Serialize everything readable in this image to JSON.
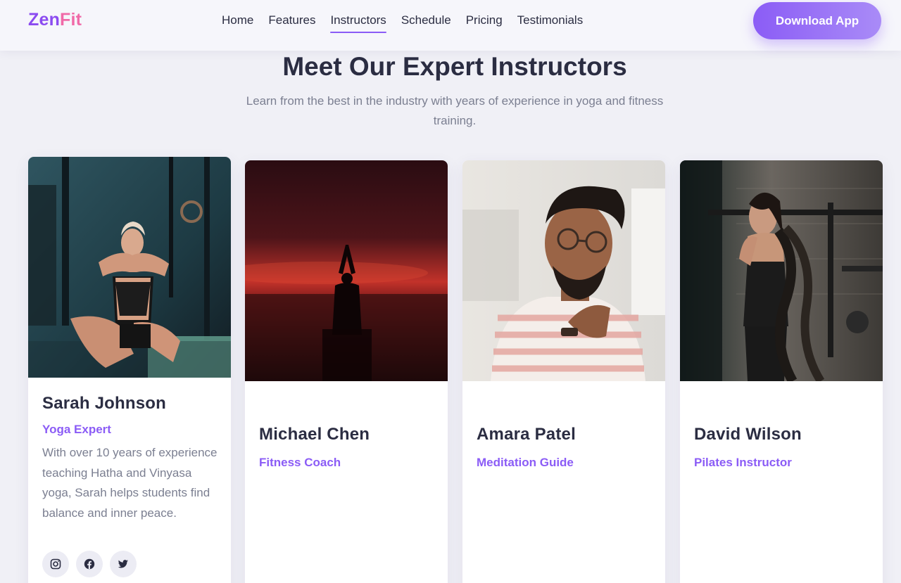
{
  "brand": {
    "part1": "Zen",
    "part2": "Fit"
  },
  "nav": {
    "links": [
      {
        "label": "Home"
      },
      {
        "label": "Features"
      },
      {
        "label": "Instructors",
        "active": true
      },
      {
        "label": "Schedule"
      },
      {
        "label": "Pricing"
      },
      {
        "label": "Testimonials"
      }
    ],
    "cta_label": "Download App"
  },
  "section": {
    "title": "Meet Our Expert Instructors",
    "subtitle": "Learn from the best in the industry with years of experience in yoga and fitness training."
  },
  "instructors": [
    {
      "name": "Sarah Johnson",
      "role": "Yoga Expert",
      "bio": "With over 10 years of experience teaching Hatha and Vinyasa yoga, Sarah helps students find balance and inner peace.",
      "socials": [
        "instagram-icon",
        "facebook-icon",
        "twitter-icon"
      ]
    },
    {
      "name": "Michael Chen",
      "role": "Fitness Coach"
    },
    {
      "name": "Amara Patel",
      "role": "Meditation Guide"
    },
    {
      "name": "David Wilson",
      "role": "Pilates Instructor"
    }
  ],
  "colors": {
    "accent": "#8b5cf6",
    "brand_purple": "#8b4bf0",
    "brand_pink": "#f06aa8",
    "page_bg": "#f0f0f6",
    "text_dark": "#2b2d42",
    "text_muted": "#7b7f91"
  }
}
